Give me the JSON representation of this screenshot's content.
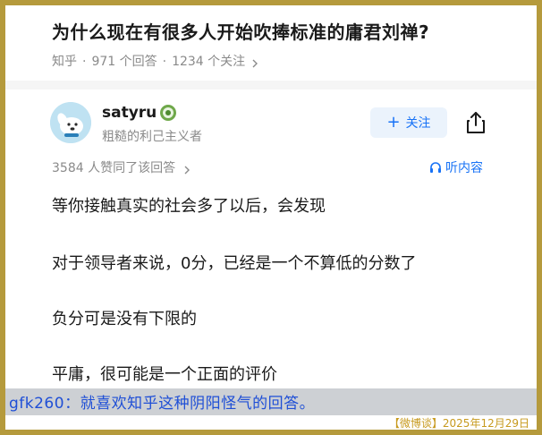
{
  "question": {
    "title": "为什么现在有很多人开始吹捧标准的庸君刘禅?",
    "source": "知乎",
    "answer_count": "971 个回答",
    "follower_count": "1234 个关注"
  },
  "answer": {
    "author_name": "satyru",
    "author_bio": "粗糙的利己主义者",
    "follow_label": "关注",
    "likes_text": "3584 人赞同了该回答",
    "listen_label": "听内容",
    "paragraphs": [
      "等你接触真实的社会多了以后，会发现",
      "对于领导者来说，0分，已经是一个不算低的分数了",
      "负分可是没有下限的",
      "平庸，很可能是一个正面的评价"
    ]
  },
  "caption": {
    "text": "gfk260：就喜欢知乎这种阴阳怪气的回答。",
    "tag": "【微博谈】2025年12月29日"
  },
  "icons": {
    "avatar": "dog-avatar-icon",
    "badge": "achievement-badge-icon",
    "share": "share-icon",
    "headphones": "headphones-icon",
    "chevron": "chevron-right-icon"
  },
  "colors": {
    "accent": "#1772f6",
    "border": "#b59a3c",
    "caption_text": "#1f4fd6",
    "date_tag": "#c79a1e"
  }
}
